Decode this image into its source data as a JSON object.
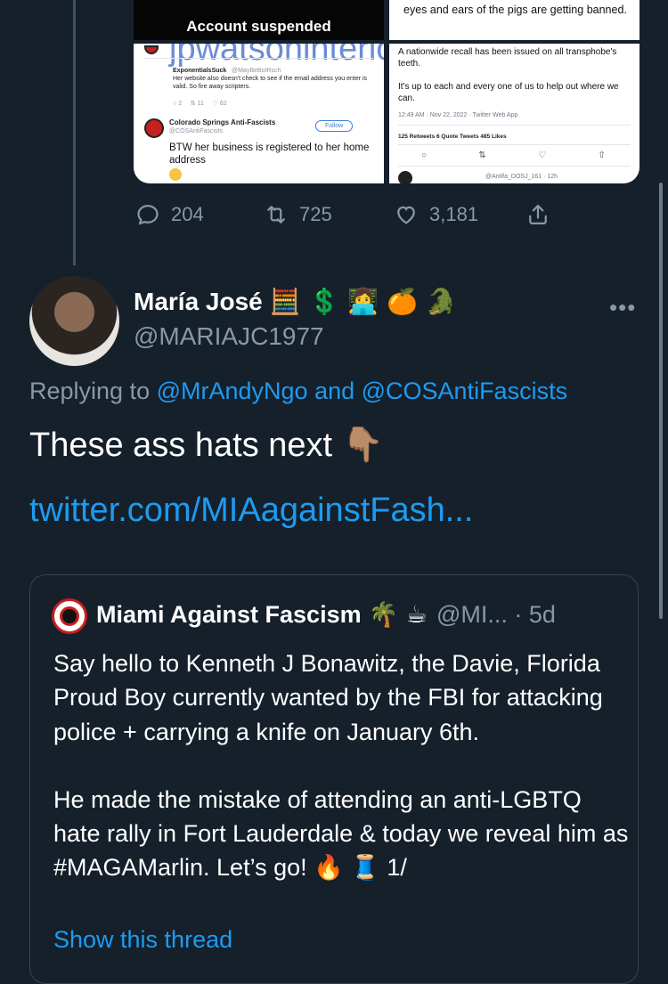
{
  "previous_tweet": {
    "media": {
      "tile1": {
        "text": "Account suspended"
      },
      "tile2": {
        "text": "eyes and ears of the pigs are getting banned."
      },
      "tile3": {
        "url": "jpwatsoninteriors.com/about",
        "reply1_name": "ExponentialsSuck",
        "reply1_handle": "@MayBeBotRsch",
        "reply1_text": "Her website also doesn't check to see if the email address you enter is valid. So fire away scripters.",
        "reply1_counts": {
          "replies": "2",
          "retweets": "11",
          "likes": "62"
        },
        "reply2_name": "Colorado Springs Anti-Fascists",
        "reply2_handle": "@COSAntiFascists",
        "follow_label": "Follow",
        "reply2_text": "BTW her business is registered to her home address"
      },
      "tile4": {
        "text1": "A nationwide recall has been issued on all transphobe's teeth.",
        "text2": "It's up to each and every one of us to help out where we can.",
        "timestamp": "12:49 AM · Nov 22, 2022 · Twitter Web App",
        "stats": "125 Retweets   6 Quote Tweets   485 Likes",
        "footer_handle": "@Antifa_DOSJ_161 · 12h"
      }
    },
    "actions": {
      "replies": "204",
      "retweets": "725",
      "likes": "3,181"
    }
  },
  "tweet": {
    "display_name": "María José",
    "name_emojis": "🧮 💲 👩‍💻 🍊 🐊",
    "handle": "@MARIAJC1977",
    "more_icon": "more-dots-icon",
    "replying_prefix": "Replying to ",
    "replying_mention1": "@MrAndyNgo",
    "replying_and": " and ",
    "replying_mention2": "@COSAntiFascists",
    "text": "These ass hats next 👇🏽",
    "link": "twitter.com/MIAagainstFash..."
  },
  "quoted_tweet": {
    "display_name": "Miami Against Fascism",
    "name_emojis": "🌴 ☕",
    "handle_time": "@MI... · 5d",
    "paragraph1": "Say hello to Kenneth J Bonawitz, the Davie, Florida Proud Boy currently wanted by the FBI for attacking police + carrying a knife on January 6th.",
    "paragraph2": "He made the mistake of attending an anti-LGBTQ hate rally in Fort Lauderdale & today we reveal him as #MAGAMarlin. Let’s go! 🔥 🧵 1/",
    "show_thread": "Show this thread"
  },
  "colors": {
    "background": "#15202b",
    "accent": "#1d9bf0",
    "muted": "#8899a6",
    "border": "#38444d"
  }
}
